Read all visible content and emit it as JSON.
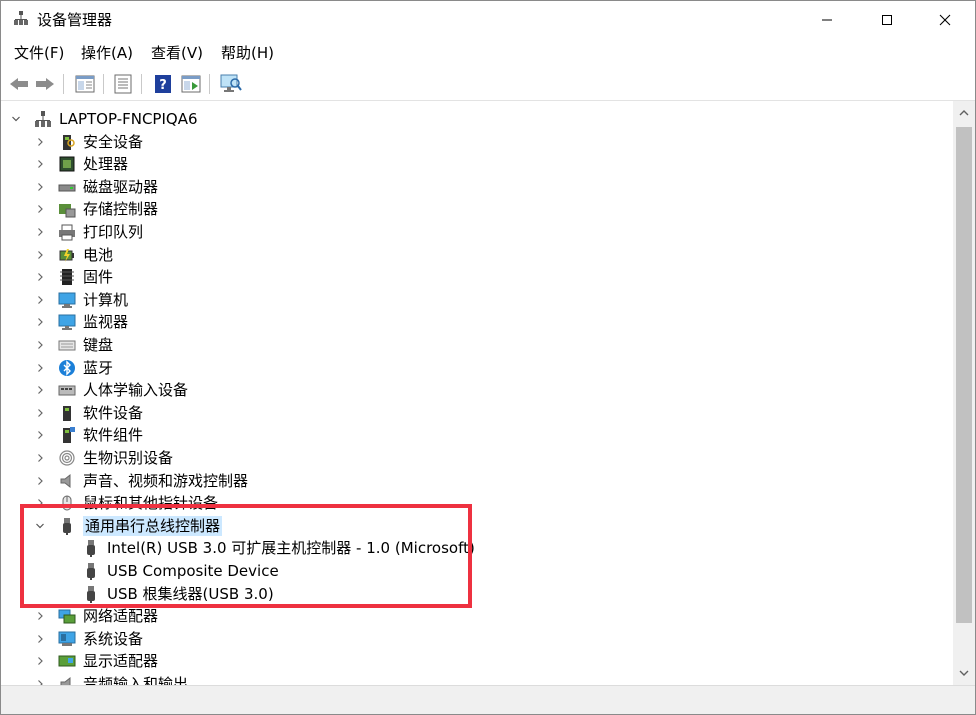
{
  "window": {
    "title": "设备管理器"
  },
  "menu": {
    "items": [
      "文件(F)",
      "操作(A)",
      "查看(V)",
      "帮助(H)"
    ]
  },
  "tree": {
    "root": "LAPTOP-FNCPIQA6",
    "categories": [
      {
        "label": "安全设备",
        "icon": "security-device-icon"
      },
      {
        "label": "处理器",
        "icon": "processor-icon"
      },
      {
        "label": "磁盘驱动器",
        "icon": "disk-drive-icon"
      },
      {
        "label": "存储控制器",
        "icon": "storage-controller-icon"
      },
      {
        "label": "打印队列",
        "icon": "printer-icon"
      },
      {
        "label": "电池",
        "icon": "battery-icon"
      },
      {
        "label": "固件",
        "icon": "firmware-icon"
      },
      {
        "label": "计算机",
        "icon": "computer-icon"
      },
      {
        "label": "监视器",
        "icon": "monitor-icon"
      },
      {
        "label": "键盘",
        "icon": "keyboard-icon"
      },
      {
        "label": "蓝牙",
        "icon": "bluetooth-icon"
      },
      {
        "label": "人体学输入设备",
        "icon": "hid-icon"
      },
      {
        "label": "软件设备",
        "icon": "software-device-icon"
      },
      {
        "label": "软件组件",
        "icon": "software-component-icon"
      },
      {
        "label": "生物识别设备",
        "icon": "biometric-icon"
      },
      {
        "label": "声音、视频和游戏控制器",
        "icon": "sound-icon"
      },
      {
        "label": "鼠标和其他指针设备",
        "icon": "mouse-icon"
      }
    ],
    "usb": {
      "label": "通用串行总线控制器",
      "children": [
        "Intel(R) USB 3.0 可扩展主机控制器 - 1.0 (Microsoft)",
        "USB Composite Device",
        "USB 根集线器(USB 3.0)"
      ]
    },
    "after": [
      {
        "label": "网络适配器",
        "icon": "network-adapter-icon"
      },
      {
        "label": "系统设备",
        "icon": "system-device-icon"
      },
      {
        "label": "显示适配器",
        "icon": "display-adapter-icon"
      },
      {
        "label": "音频输入和输出",
        "icon": "audio-io-icon"
      }
    ]
  }
}
